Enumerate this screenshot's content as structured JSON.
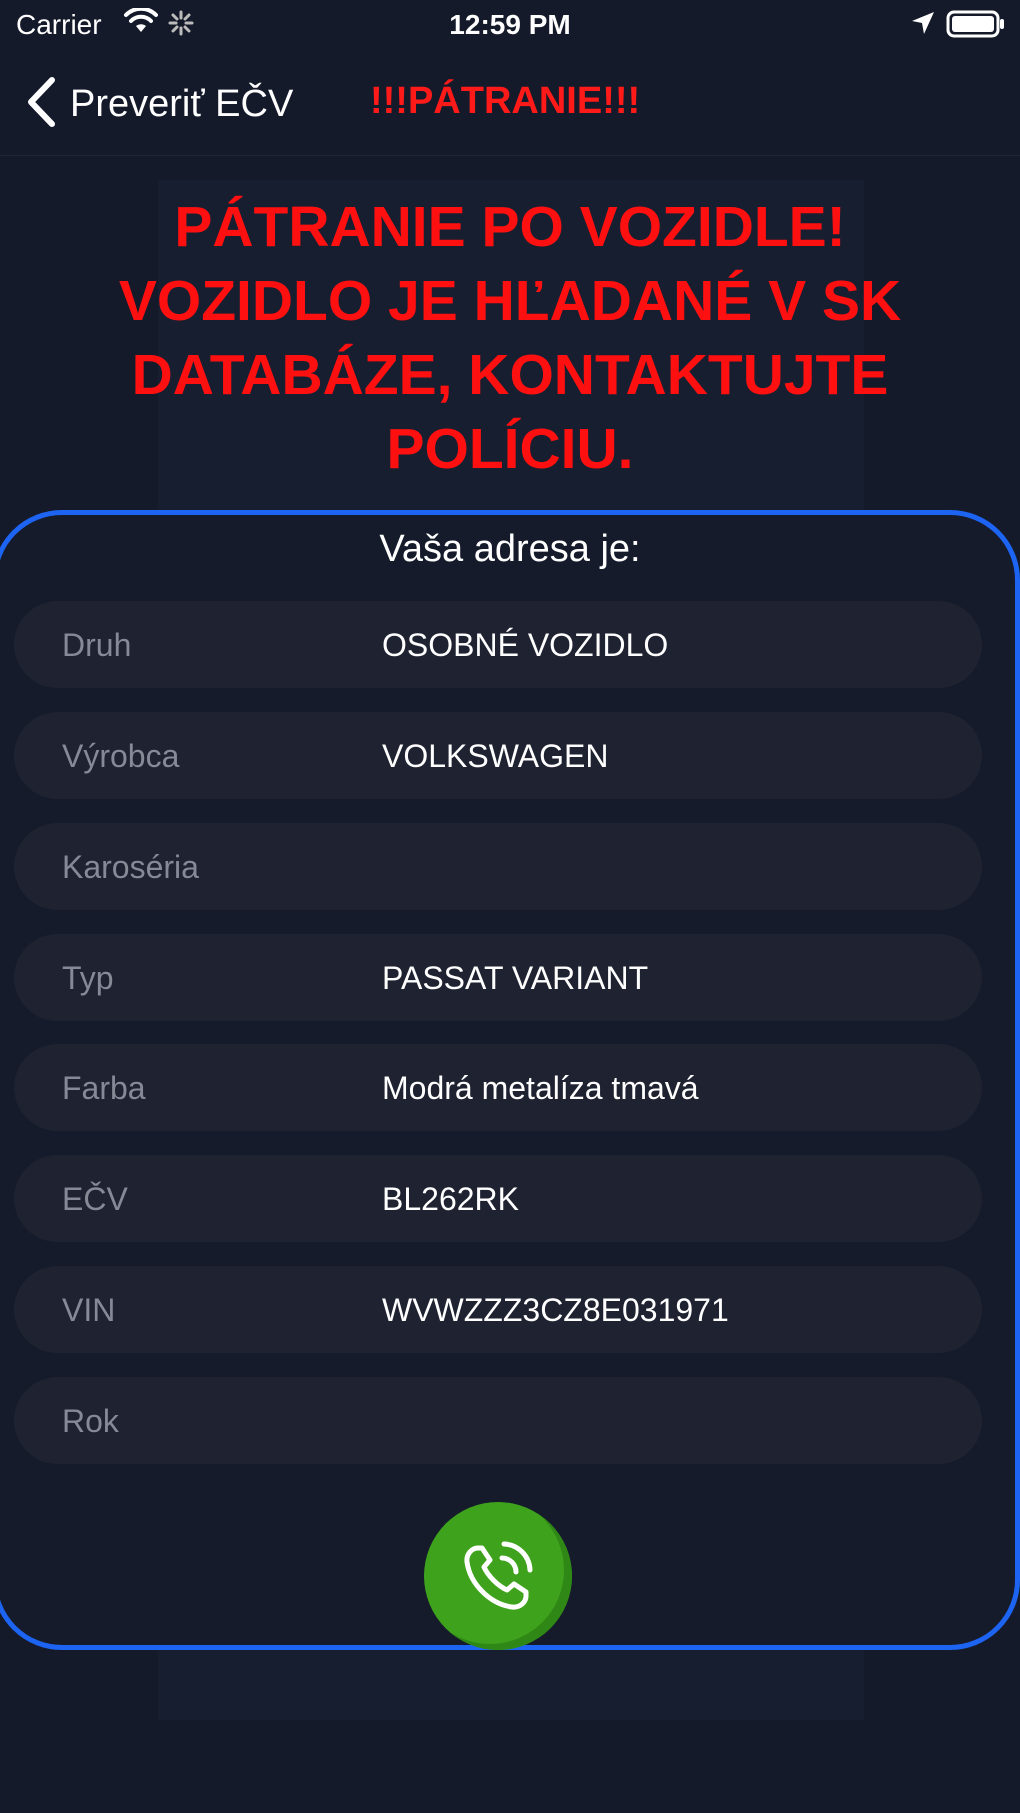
{
  "status_bar": {
    "carrier": "Carrier",
    "time": "12:59 PM",
    "icons": [
      "wifi-icon",
      "activity-icon",
      "location-icon",
      "battery-icon"
    ]
  },
  "nav": {
    "back_label": "Preveriť EČV",
    "back_icon": "chevron-left-icon",
    "title": "!!!PÁTRANIE!!!"
  },
  "alert": {
    "lines": [
      "PÁTRANIE PO VOZIDLE!",
      "VOZIDLO JE HĽADANÉ V SK",
      "DATABÁZE, KONTAKTUJTE",
      "POLÍCIU."
    ]
  },
  "panel": {
    "heading": "Vaša adresa je:",
    "rows": [
      {
        "label": "Druh",
        "value": "OSOBNÉ VOZIDLO"
      },
      {
        "label": "Výrobca",
        "value": "VOLKSWAGEN"
      },
      {
        "label": "Karoséria",
        "value": ""
      },
      {
        "label": "Typ",
        "value": "PASSAT VARIANT"
      },
      {
        "label": "Farba",
        "value": "Modrá metalíza tmavá"
      },
      {
        "label": "EČV",
        "value": "BL262RK"
      },
      {
        "label": "VIN",
        "value": "WVWZZZ3CZ8E031971"
      },
      {
        "label": "Rok",
        "value": ""
      }
    ]
  },
  "call_button": {
    "icon": "phone-call-icon"
  },
  "colors": {
    "background": "#141a2a",
    "alert_red": "#ff1010",
    "panel_border": "#1d64f2",
    "row_background": "#1e2231",
    "label_gray": "#858a96",
    "call_green": "#3ea21c"
  }
}
